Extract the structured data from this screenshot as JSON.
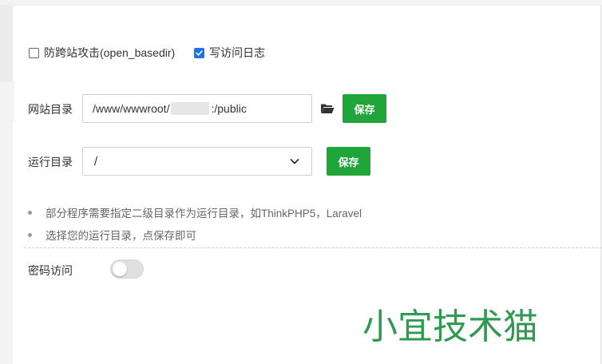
{
  "options": {
    "anti_crosssite_label": "防跨站攻击(open_basedir)",
    "anti_crosssite_checked": false,
    "access_log_label": "写访问日志",
    "access_log_checked": true
  },
  "site_dir": {
    "label": "网站目录",
    "value_prefix": "/www/wwwroot/",
    "value_suffix": ":/public",
    "folder_icon": "folder-open-icon",
    "save_label": "保存"
  },
  "run_dir": {
    "label": "运行目录",
    "selected": "/",
    "save_label": "保存"
  },
  "tips": [
    "部分程序需要指定二级目录作为运行目录，如ThinkPHP5，Laravel",
    "选择您的运行目录，点保存即可"
  ],
  "password_access": {
    "label": "密码访问",
    "enabled": false
  },
  "watermark": {
    "text": "小宜技术猫"
  },
  "colors": {
    "accent_green": "#20a53a",
    "checkbox_blue": "#1a73e8",
    "watermark_green": "#2e9a52"
  }
}
